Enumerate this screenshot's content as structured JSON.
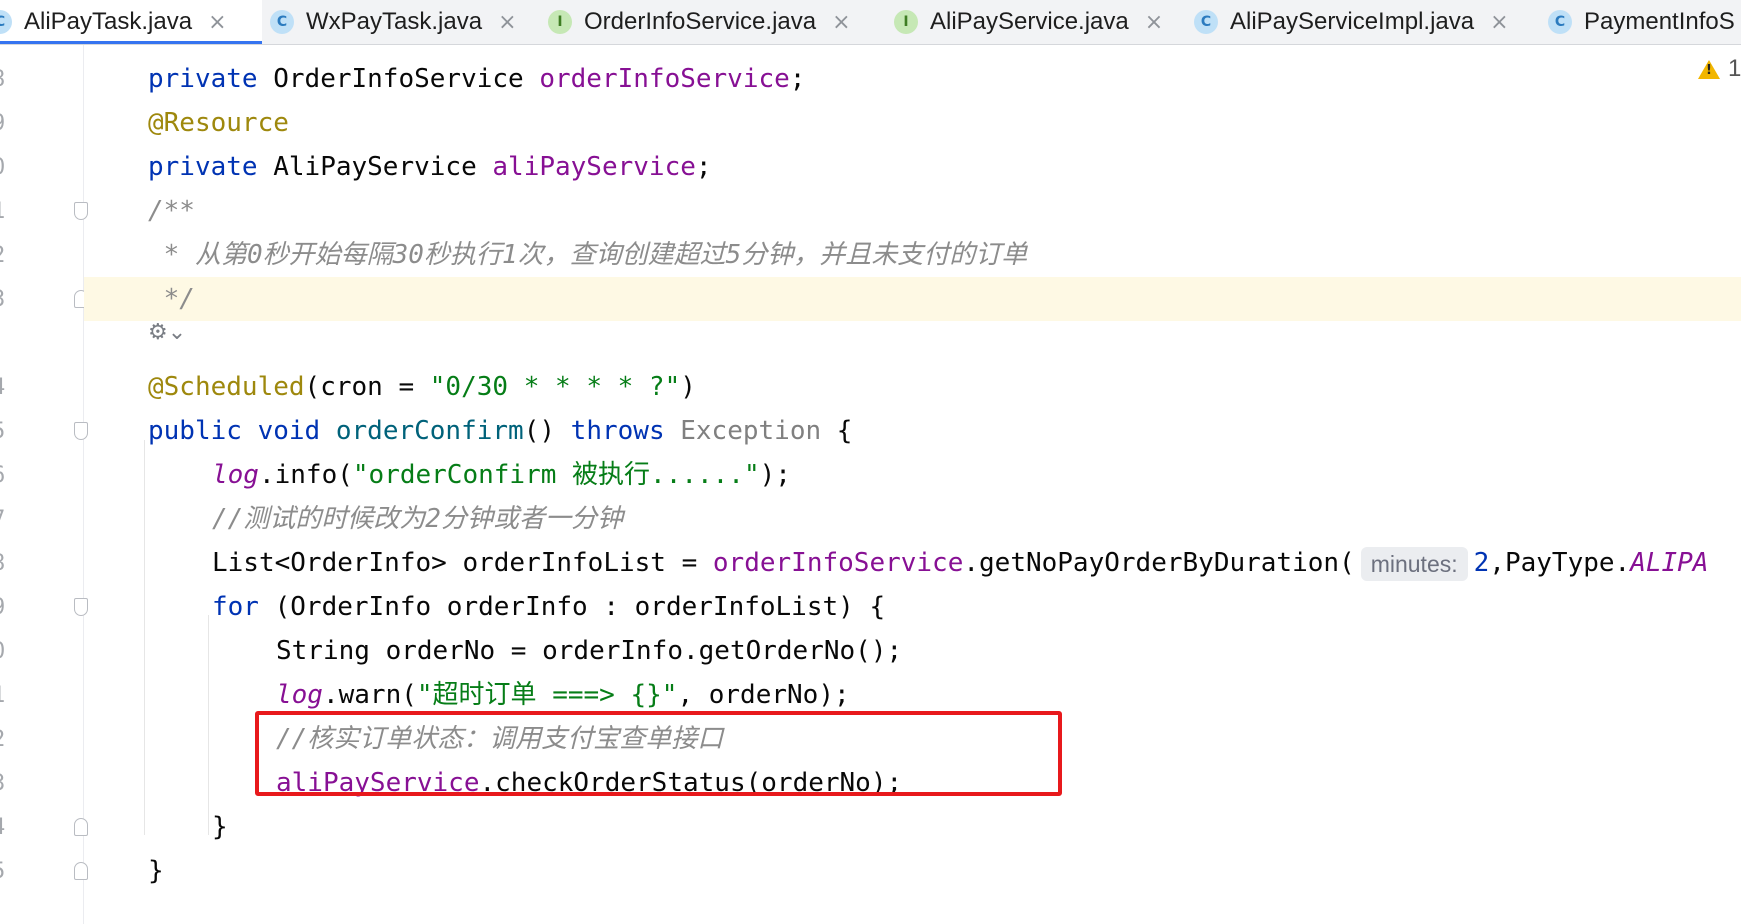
{
  "tabs": [
    {
      "label": "AliPayTask.java",
      "icon": "C",
      "active": true
    },
    {
      "label": "WxPayTask.java",
      "icon": "C"
    },
    {
      "label": "OrderInfoService.java",
      "icon": "I"
    },
    {
      "label": "AliPayService.java",
      "icon": "I"
    },
    {
      "label": "AliPayServiceImpl.java",
      "icon": "C"
    },
    {
      "label": "PaymentInfoS",
      "icon": "C"
    }
  ],
  "close_glyph": "×",
  "warning_count": "1",
  "line_numbers": [
    "8",
    "9",
    "0",
    "1",
    "2",
    "3",
    "4",
    "5",
    "6",
    "7",
    "8",
    "9",
    "0",
    "1",
    "2",
    "3",
    "4",
    "5"
  ],
  "code": {
    "l1": [
      "private",
      "OrderInfoService",
      "orderInfoService",
      ";"
    ],
    "l2": [
      "@Resource"
    ],
    "l3": [
      "private",
      "AliPayService",
      "aliPayService",
      ";"
    ],
    "l4": [
      "/**"
    ],
    "l5": [
      " * 从第0秒开始每隔30秒执行1次，查询创建超过5分钟，并且未支付的订单"
    ],
    "l6": [
      " */"
    ],
    "l7": [
      "@Scheduled",
      "(cron = ",
      "\"0/30 * * * * ?\"",
      ")"
    ],
    "l8": [
      "public",
      "void",
      "orderConfirm",
      "()",
      "throws",
      "Exception",
      " {"
    ],
    "l9": [
      "log",
      ".info(",
      "\"orderConfirm 被执行......\"",
      ");"
    ],
    "l10": [
      "//测试的时候改为2分钟或者一分钟"
    ],
    "l11": [
      "List<OrderInfo> orderInfoList = ",
      "orderInfoService",
      ".getNoPayOrderByDuration(",
      "minutes:",
      "2",
      ",PayType.",
      "ALIPA"
    ],
    "l12": [
      "for",
      " (OrderInfo orderInfo : orderInfoList) {"
    ],
    "l13": [
      "String orderNo = orderInfo.getOrderNo();"
    ],
    "l14": [
      "log",
      ".warn(",
      "\"超时订单 ===> {}\"",
      ", orderNo);"
    ],
    "l15": [
      "//核实订单状态：调用支付宝查单接口"
    ],
    "l16": [
      "aliPayService",
      ".checkOrderStatus(orderNo);"
    ],
    "l17": [
      "}"
    ],
    "l18": [
      "}"
    ]
  },
  "colors": {
    "keyword": "#0033b3",
    "field": "#871094",
    "annotation": "#9e880d",
    "string": "#067d17",
    "comment": "#8c8c8c",
    "highlight_box": "#e8191c",
    "caret_line": "#fef9e4"
  },
  "icons": {
    "class_tab": "class-icon",
    "interface_tab": "interface-icon",
    "close": "close-icon",
    "warning": "warning-icon",
    "run_settings": "gear-icon"
  }
}
